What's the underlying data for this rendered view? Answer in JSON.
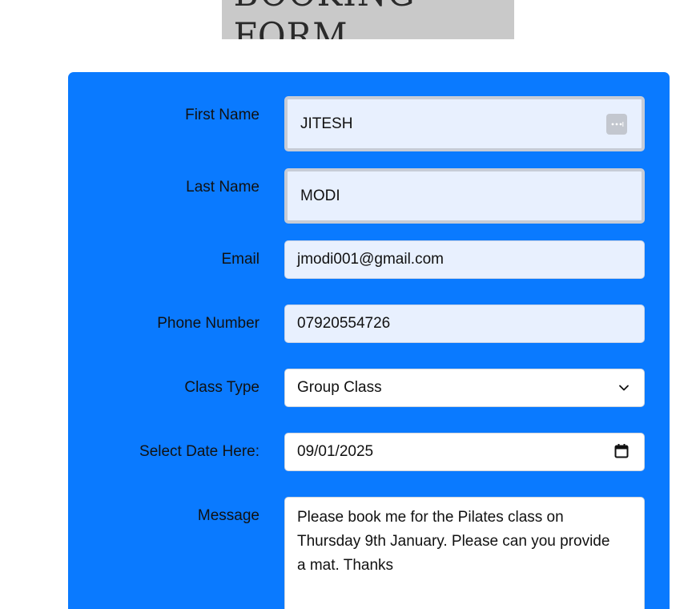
{
  "page": {
    "title": "BOOKING FORM"
  },
  "form": {
    "first_name": {
      "label": "First Name",
      "value": "JITESH"
    },
    "last_name": {
      "label": "Last Name",
      "value": "MODI"
    },
    "email": {
      "label": "Email",
      "value": "jmodi001@gmail.com"
    },
    "phone": {
      "label": "Phone Number",
      "value": "07920554726"
    },
    "class_type": {
      "label": "Class Type",
      "selected": "Group Class"
    },
    "date": {
      "label": "Select Date Here:",
      "value": "09/01/2025"
    },
    "message": {
      "label": "Message",
      "value": "Please book me for the Pilates class on Thursday 9th January. Please can you provide a mat. Thanks"
    }
  },
  "icons": {
    "autofill": "password-manager-key-icon",
    "dropdown": "chevron-down-icon",
    "date": "calendar-icon"
  },
  "colors": {
    "panel": "#0a7aff",
    "autofill_bg": "#e8f0fe",
    "title_bg": "#c9c9c9"
  }
}
